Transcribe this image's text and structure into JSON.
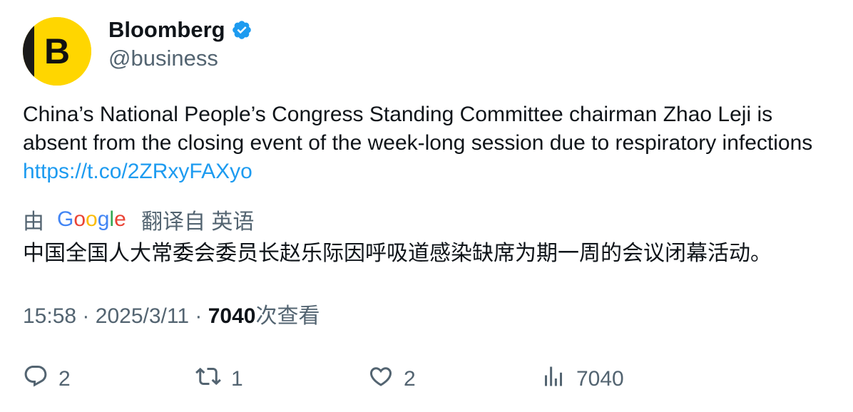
{
  "author": {
    "avatar_letter": "B",
    "name": "Bloomberg",
    "handle": "@business"
  },
  "tweet": {
    "text": "China’s National People’s Congress Standing Committee chairman Zhao Leji is absent from the closing event of the week-long session due to respiratory infections ",
    "link": "https://t.co/2ZRxyFAXyo"
  },
  "translation": {
    "prefix": "由",
    "provider": "Google",
    "suffix": "翻译自 英语",
    "text": "中国全国人大常委会委员长赵乐际因呼吸道感染缺席为期一周的会议闭幕活动。"
  },
  "meta": {
    "time": "15:58",
    "separator": "·",
    "date": "2025/3/11",
    "views": "7040",
    "views_suffix": "次查看"
  },
  "actions": {
    "replies": "2",
    "retweets": "1",
    "likes": "2",
    "views": "7040"
  },
  "colors": {
    "link": "#1d9bf0",
    "secondary_text": "#536471",
    "primary_text": "#0f1419",
    "verified_badge": "#1d9bf0",
    "avatar_bg": "#ffd600"
  }
}
